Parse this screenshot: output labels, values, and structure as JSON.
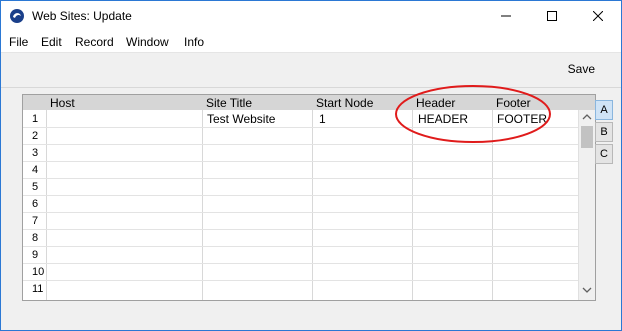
{
  "window": {
    "title": "Web Sites: Update",
    "controls": {
      "minimize": "minimize",
      "maximize": "maximize",
      "close": "close"
    }
  },
  "menu": {
    "items": [
      "File",
      "Edit",
      "Record",
      "Window",
      "Info"
    ]
  },
  "toolbar": {
    "save_label": "Save"
  },
  "grid": {
    "columns": [
      "Host",
      "Site Title",
      "Start Node",
      "Header",
      "Footer"
    ],
    "row_numbers": [
      "1",
      "2",
      "3",
      "4",
      "5",
      "6",
      "7",
      "8",
      "9",
      "10",
      "11"
    ],
    "rows": [
      {
        "host": "",
        "site_title": "Test Website",
        "start_node": "1",
        "header": "HEADER",
        "footer": "FOOTER"
      }
    ]
  },
  "side_tabs": [
    "A",
    "B",
    "C"
  ],
  "colors": {
    "annotation_ellipse": "#e01b1b",
    "header_bg": "#d6d6d6",
    "active_tab": "#cfe3f6"
  }
}
